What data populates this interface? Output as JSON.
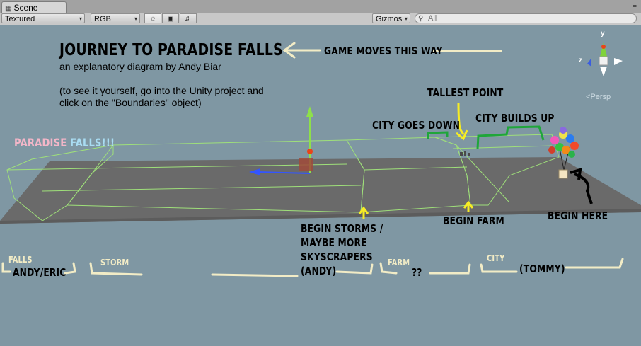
{
  "tab": {
    "title": "Scene"
  },
  "toolbar": {
    "render_mode": "Textured",
    "color_mode": "RGB",
    "gizmos_label": "Gizmos",
    "search_placeholder": "All"
  },
  "gizmo": {
    "y_label": "y",
    "z_label": "z",
    "x_label": "x",
    "projection": "Persp"
  },
  "diagram": {
    "title": "JOURNEY TO PARADISE FALLS",
    "subtitle": "an explanatory diagram by Andy Biar",
    "note_line1": "(to see it yourself, go into the Unity project and",
    "note_line2": "click on the \"Boundaries\" object)",
    "game_direction": "GAME MOVES THIS WAY",
    "paradise_word": "PARADISE",
    "falls_word": "FALLS!!!",
    "tallest_point": "TALLEST POINT",
    "city_goes_down": "CITY GOES DOWN",
    "city_builds_up": "CITY BUILDS UP",
    "begin_storms_l1": "BEGIN STORMS /",
    "begin_storms_l2": "MAYBE MORE",
    "begin_storms_l3": "SKYSCRAPERS",
    "begin_storms_l4": "(ANDY)",
    "begin_farm": "BEGIN FARM",
    "begin_here": "BEGIN HERE"
  },
  "sections": {
    "falls_label": "FALLS",
    "falls_owner": "ANDY/ERIC",
    "storm_label": "STORM",
    "farm_label": "FARM",
    "farm_owner": "??",
    "city_label": "CITY",
    "city_owner": "(TOMMY)"
  },
  "colors": {
    "viewport_bg": "#7f97a3",
    "ground": "#6a6a6a",
    "boundary_lines": "#9fe07a",
    "paradise_pink": "#f4b6c8",
    "falls_blue": "#a9dcf2",
    "section_bracket": "#f2ecc6",
    "arrow_yellow": "#f6ec24",
    "bracket_green": "#1fa63a"
  }
}
